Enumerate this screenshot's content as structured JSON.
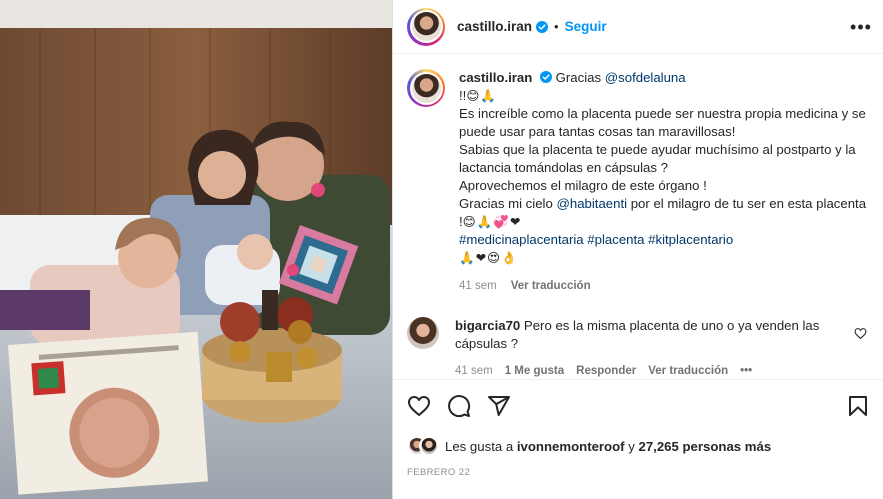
{
  "post": {
    "author": "castillo.iran",
    "follow_label": "Seguir",
    "separator": "•",
    "more_label": "•••"
  },
  "caption": {
    "author": "castillo.iran",
    "thanks": "Gracias ",
    "mention_1": "@sofdelaluna",
    "line_1_prefix": "!!",
    "line_1_emoji": "😊🙏",
    "line_2": "Es increíble como la placenta puede ser nuestra propia medicina y se puede usar para tantas cosas tan maravillosas!",
    "line_3": "Sabias que la placenta te puede ayudar muchísimo al postparto y la lactancia tomándolas en cápsulas ?",
    "line_4": "Aprovechemos el milagro de este órgano !",
    "line_5_prefix": "Gracias mi cielo ",
    "mention_2": "@habitaenti",
    "line_5_suffix": " por el milagro de tu ser en esta placenta !",
    "line_5_emoji": "😊🙏💞❤",
    "hashtags": "#medicinaplacentaria #placenta #kitplacentario",
    "end_emoji": "🙏❤😍👌",
    "time_ago": "41 sem",
    "see_translation": "Ver traducción"
  },
  "comment": {
    "author": "bigarcia70",
    "text": "Pero es la misma placenta de uno o ya venden las cápsulas ?",
    "time_ago": "41 sem",
    "likes": "1 Me gusta",
    "reply": "Responder",
    "see_translation": "Ver traducción",
    "more": "•••"
  },
  "likes": {
    "prefix": "Les gusta a ",
    "user": "ivonnemonteroof",
    "middle": " y ",
    "count": "27,265 personas más"
  },
  "date": "FEBRERO 22",
  "colors": {
    "link_blue": "#0095f6",
    "mention_dark": "#00376b",
    "muted": "#8e8e8e",
    "text": "#262626",
    "border": "#dbdbdb"
  },
  "icons": [
    "verified-icon",
    "heart-icon",
    "comment-icon",
    "share-icon",
    "bookmark-icon",
    "more-icon"
  ]
}
